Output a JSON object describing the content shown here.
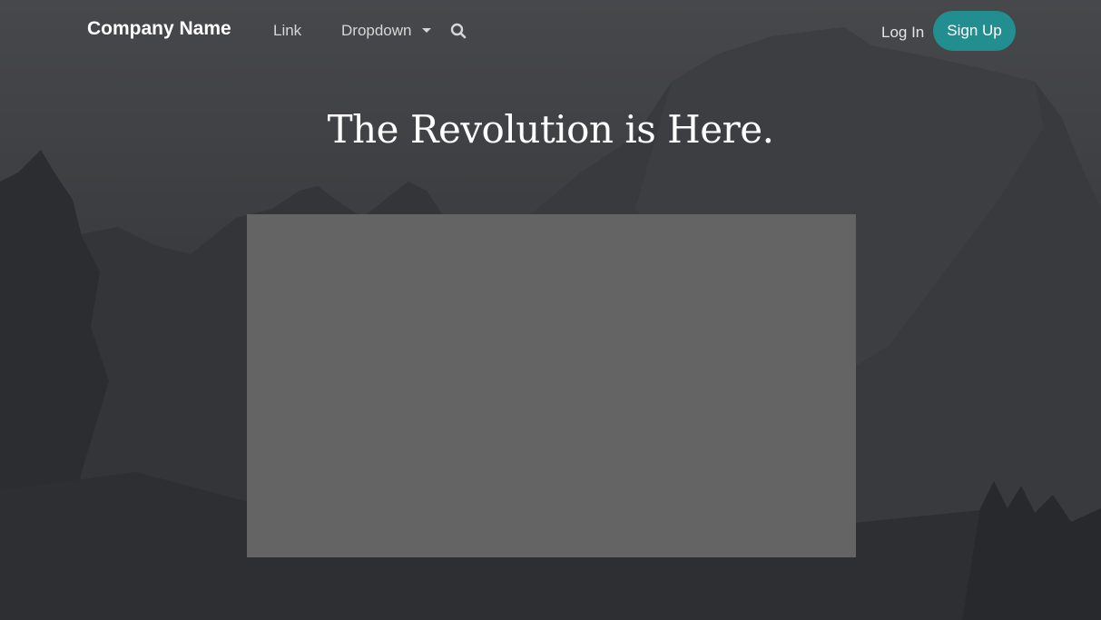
{
  "navbar": {
    "brand": "Company Name",
    "links": [
      "Link",
      "Dropdown"
    ],
    "search_icon": "search-icon",
    "login_label": "Log In",
    "signup_label": "Sign Up"
  },
  "hero": {
    "headline": "The Revolution is Here."
  },
  "colors": {
    "accent": "#238e8f",
    "placeholder": "#646464",
    "background": "#3d3e41"
  }
}
